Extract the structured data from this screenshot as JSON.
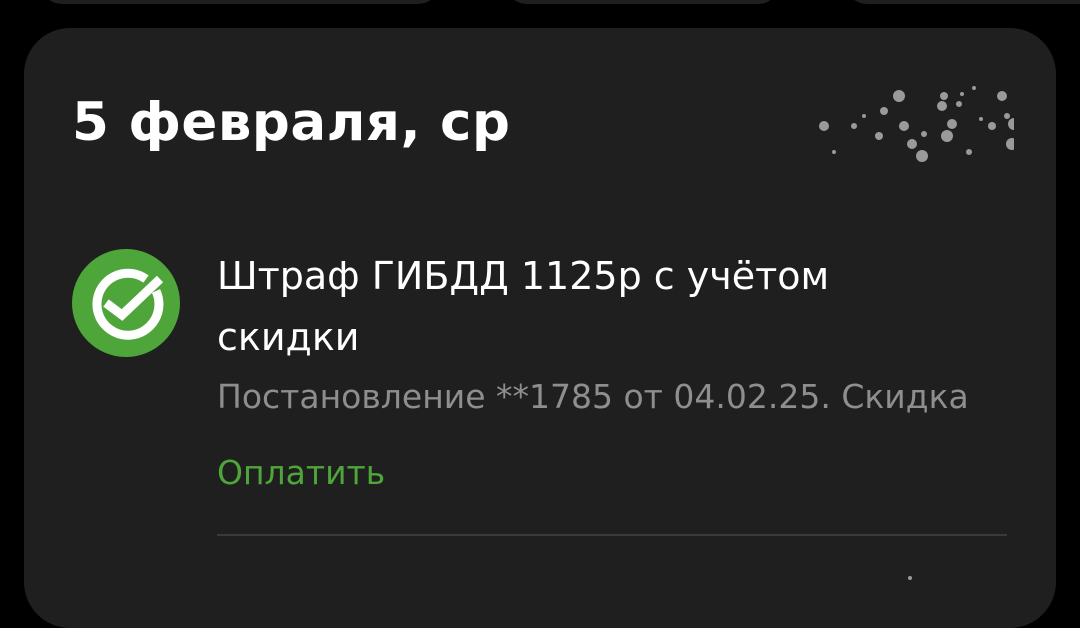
{
  "colors": {
    "background": "#000000",
    "card": "#1f1f1f",
    "title_text": "#ffffff",
    "secondary_text": "#8e8e8e",
    "accent_green": "#4ea53a",
    "divider": "#3a3a3a"
  },
  "feed": {
    "date_heading": "5 февраля, ср",
    "decoration_icon": "sparkle-dots-icon",
    "operation": {
      "icon": "sberbank-check-logo-icon",
      "title": "Штраф ГИБДД 1125р с учётом скидки",
      "description": "Постановление **1785 от 04.02.25. Скидка",
      "action_label": "Оплатить"
    }
  }
}
